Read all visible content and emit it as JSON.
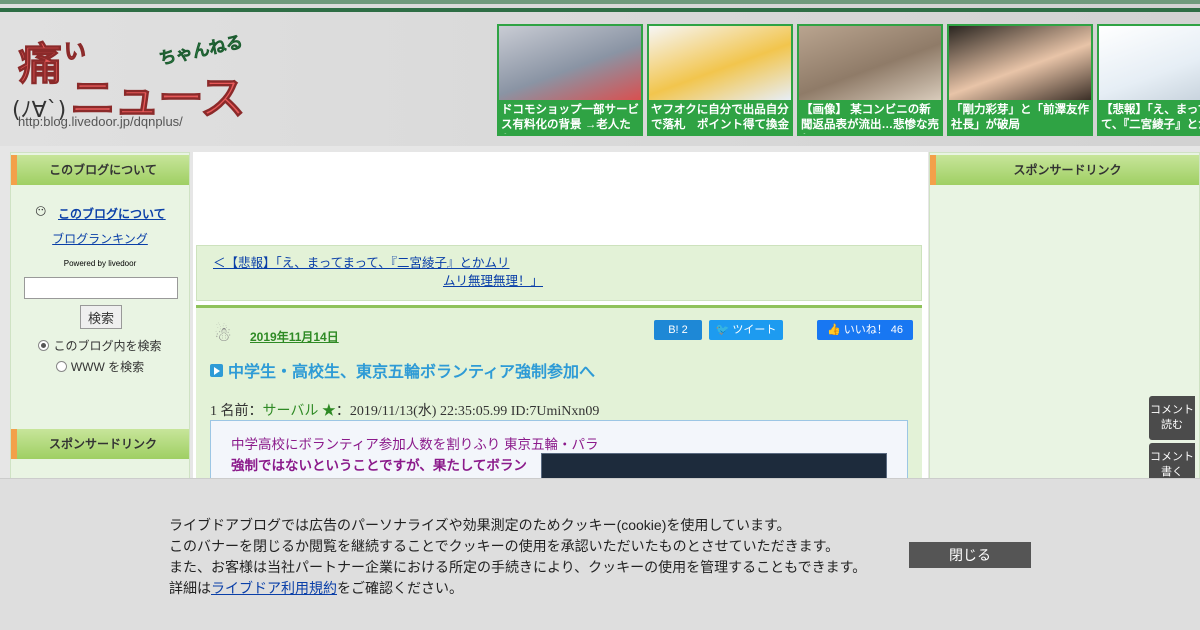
{
  "header": {
    "logo": {
      "kanji": "痛",
      "small": "い",
      "news": "ニュース",
      "chan": "ちゃんねる",
      "face": "(ﾉ∀`)",
      "url": "http:blog.livedoor.jp/dqnplus/"
    },
    "thumbnails": [
      {
        "caption": "ドコモショップ一部サービス有料化の背景 →老人たち",
        "colors": [
          "#c9ccd4",
          "#8a94a4",
          "#d95050"
        ]
      },
      {
        "caption": "ヤフオクに自分で出品自分で落札　ポイント得て換金",
        "colors": [
          "#f6f6f6",
          "#f2c54d",
          "#e7eef7"
        ]
      },
      {
        "caption": "【画像】 某コンビニの新聞返品表が流出…悲惨な売り",
        "colors": [
          "#b9a48f",
          "#8f7b68",
          "#d8cbbb"
        ]
      },
      {
        "caption": "「剛力彩芽」と「前澤友作社長」が破局",
        "colors": [
          "#2a2520",
          "#e8c4a8",
          "#3b2f27"
        ]
      },
      {
        "caption": "【悲報】「え、まってまって、『二宮綾子』とか",
        "colors": [
          "#ffffff",
          "#e6eef5",
          "#bfcbd6"
        ]
      }
    ]
  },
  "left_sidebar": {
    "about_header": "このブログについて",
    "about_link": "このブログについて",
    "ranking_link": "ブログランキング",
    "powered_by": "Powered by livedoor",
    "search_placeholder": "",
    "search_button": "検索",
    "radio_blog": "このブログ内を検索",
    "radio_www": "WWW を検索",
    "sponsor_header": "スポンサードリンク"
  },
  "nav": {
    "prev_line1": "＜【悲報】「え、まってまって、『二宮綾子』とかムリ",
    "prev_line2": "ムリ無理無理！」"
  },
  "article": {
    "date": "2019年11月14日",
    "hatena": "B! 2",
    "tweet": "ツイート",
    "like": "いいね！ 46",
    "title": "中学生・高校生、東京五輪ボランティア強制参加へ",
    "res_prefix": "1 名前：",
    "res_name": "サーバル ★",
    "res_suffix": "：2019/11/13(水) 22:35:05.99 ID:7UmiNxn09",
    "quote_headline": "中学高校にボランティア参加人数を割りふり 東京五輪・パラ",
    "quote_bold": "強制ではないということですが、果たしてボランティアというそのでしょうか"
  },
  "right_sidebar": {
    "sponsor_header": "スポンサードリンク"
  },
  "floating": {
    "read": "コメント読む",
    "write": "コメント書く"
  },
  "cookie": {
    "line1": "ライブドアブログでは広告のパーソナライズや効果測定のためクッキー(cookie)を使用しています。",
    "line2": "このバナーを閉じるか閲覧を継続することでクッキーの使用を承認いただいたものとさせていただきます。",
    "line3": "また、お客様は当社パートナー企業における所定の手続きにより、クッキーの使用を管理することもできます。",
    "line4_prefix": "詳細は",
    "line4_link": "ライブドア利用規約",
    "line4_suffix": "をご確認ください。",
    "close_button": "閉じる"
  }
}
